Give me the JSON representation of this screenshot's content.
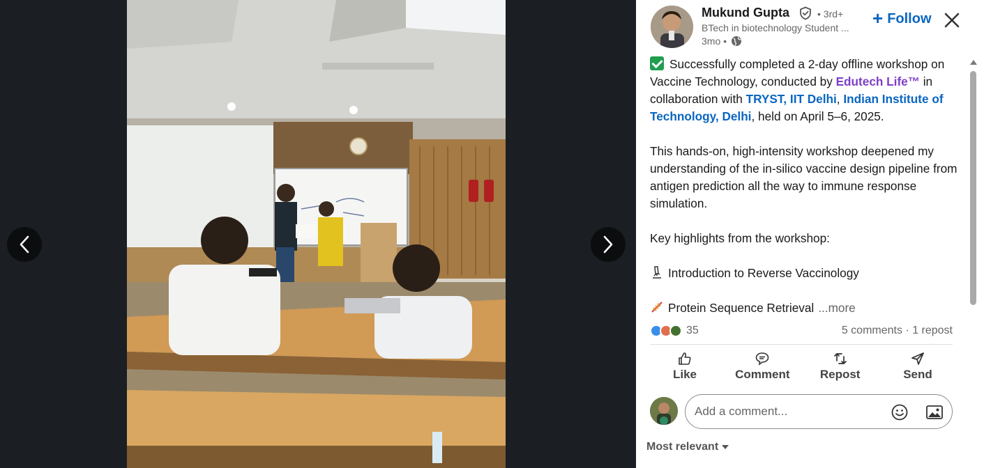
{
  "viewer": {
    "prev_icon": "chevron-left-icon",
    "next_icon": "chevron-right-icon",
    "photo_alt": "Workshop certificate presentation in a lecture hall"
  },
  "post": {
    "author": {
      "name": "Mukund Gupta",
      "verified_icon": "verified-shield-icon",
      "degree": "• 3rd+",
      "headline": "BTech in biotechnology Student ...",
      "time": "3mo •",
      "visibility_icon": "globe-icon"
    },
    "follow_label": "Follow",
    "close_icon": "close-icon",
    "body": {
      "line1_a": "Successfully completed a 2-day offline workshop on Vaccine Technology, conducted by ",
      "mention_edutech": "Edutech Life™",
      "line1_b": " in collaboration with ",
      "mention_tryst": "TRYST, IIT Delhi",
      "line1_c": ", ",
      "mention_iit": "Indian Institute of Technology, Delhi",
      "line1_d": ", held on April 5–6, 2025.",
      "para2": "This hands-on, high-intensity workshop deepened my understanding of the in-silico vaccine design pipeline from antigen prediction all the way to immune response simulation.",
      "para3": "Key highlights from the workshop:",
      "highlight1": "Introduction to Reverse Vaccinology",
      "highlight2": "Protein Sequence Retrieval",
      "more_label": "...more"
    },
    "social": {
      "reaction_count": "35",
      "comments_reposts": "5 comments · 1 repost",
      "reaction_colors": [
        "#378fe9",
        "#df704d",
        "#44712e"
      ]
    },
    "actions": [
      {
        "label": "Like",
        "icon": "thumbs-up-icon"
      },
      {
        "label": "Comment",
        "icon": "comment-icon"
      },
      {
        "label": "Repost",
        "icon": "repost-icon"
      },
      {
        "label": "Send",
        "icon": "send-icon"
      }
    ],
    "comment_box": {
      "placeholder": "Add a comment...",
      "emoji_icon": "emoji-icon",
      "image_icon": "image-icon"
    },
    "sort_label": "Most relevant"
  },
  "colors": {
    "accent_blue": "#0a66c2",
    "mention_purple": "#7d3fc6",
    "viewer_bg": "#1b1f23"
  }
}
